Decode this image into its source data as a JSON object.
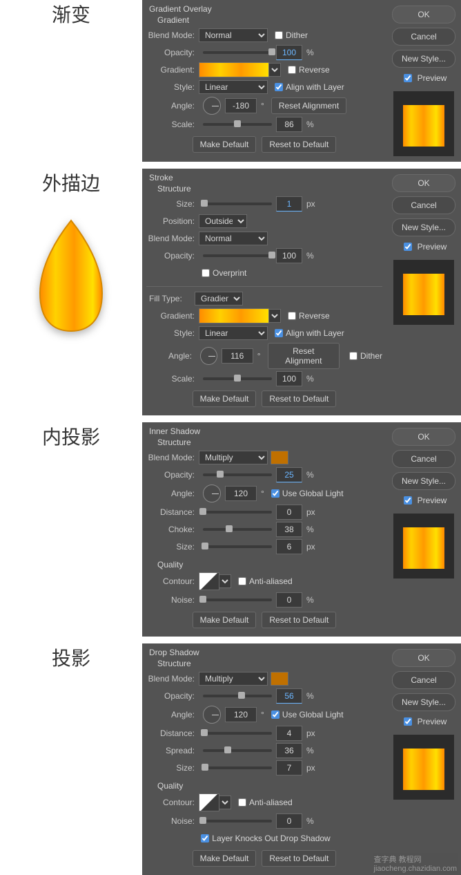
{
  "labels_cn": {
    "gradient": "渐变",
    "stroke": "外描边",
    "inner": "内投影",
    "drop": "投影"
  },
  "common": {
    "blendMode": "Blend Mode:",
    "opacity": "Opacity:",
    "gradient": "Gradient:",
    "style": "Style:",
    "angle": "Angle:",
    "scale": "Scale:",
    "size": "Size:",
    "position": "Position:",
    "fillType": "Fill Type:",
    "distance": "Distance:",
    "choke": "Choke:",
    "spread": "Spread:",
    "contour": "Contour:",
    "noise": "Noise:",
    "quality": "Quality",
    "structure": "Structure",
    "makeDefault": "Make Default",
    "resetDefault": "Reset to Default",
    "resetAlign": "Reset Alignment",
    "dither": "Dither",
    "reverse": "Reverse",
    "alignLayer": "Align with Layer",
    "overprint": "Overprint",
    "antiAliased": "Anti-aliased",
    "useGlobal": "Use Global Light",
    "layerKnocks": "Layer Knocks Out Drop Shadow",
    "percent": "%",
    "px": "px",
    "deg": "°"
  },
  "side": {
    "ok": "OK",
    "cancel": "Cancel",
    "newStyle": "New Style...",
    "preview": "Preview"
  },
  "gradientOverlay": {
    "title": "Gradient Overlay",
    "sub": "Gradient",
    "blend": "Normal",
    "opacity": "100",
    "style": "Linear",
    "angle": "-180",
    "scale": "86"
  },
  "stroke": {
    "title": "Stroke",
    "size": "1",
    "position": "Outside",
    "blend": "Normal",
    "opacity": "100",
    "fillType": "Gradient",
    "style": "Linear",
    "angle": "116",
    "scale": "100"
  },
  "innerShadow": {
    "title": "Inner Shadow",
    "blend": "Multiply",
    "color": "#c07000",
    "opacity": "25",
    "angle": "120",
    "distance": "0",
    "choke": "38",
    "size": "6",
    "noise": "0"
  },
  "dropShadow": {
    "title": "Drop Shadow",
    "blend": "Multiply",
    "color": "#c07000",
    "opacity": "56",
    "angle": "120",
    "distance": "4",
    "spread": "36",
    "size": "7",
    "noise": "0"
  },
  "watermark": {
    "site": "查字典 教程网",
    "url": "jiaocheng.chazidian.com"
  }
}
